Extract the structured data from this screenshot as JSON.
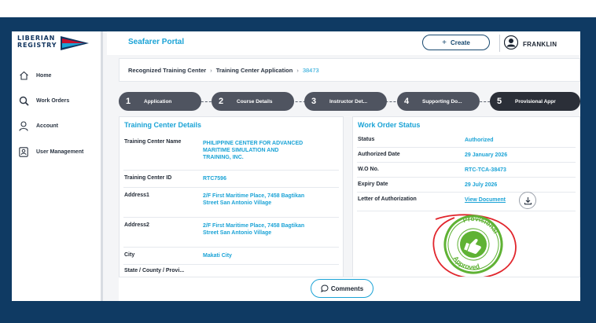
{
  "brand": {
    "logo_line1": "LIBERIAN",
    "logo_line2": "REGISTRY",
    "logo_colors": [
      "#c8102e",
      "#12355f",
      "#1ba3d6"
    ]
  },
  "sidebar": {
    "items": [
      {
        "label": "Home",
        "icon": "home-icon"
      },
      {
        "label": "Work Orders",
        "icon": "search-icon"
      },
      {
        "label": "Account",
        "icon": "user-icon"
      },
      {
        "label": "User Management",
        "icon": "user-management-icon"
      }
    ]
  },
  "header": {
    "title": "Seafarer Portal",
    "create_label": "Create",
    "user_name": "FRANKLIN"
  },
  "breadcrumb": {
    "items": [
      "Recognized Training Center",
      "Training Center Application"
    ],
    "current": "38473"
  },
  "stepper": {
    "steps": [
      {
        "number": "1",
        "label": "Application"
      },
      {
        "number": "2",
        "label": "Course Details"
      },
      {
        "number": "3",
        "label": "Instructor Det..."
      },
      {
        "number": "4",
        "label": "Supporting Do..."
      },
      {
        "number": "5",
        "label": "Provisional Appr"
      }
    ]
  },
  "training_center": {
    "title": "Training Center Details",
    "rows": [
      {
        "label": "Training Center Name",
        "value": "PHILIPPINE CENTER FOR ADVANCED MARITIME SIMULATION AND TRAINING, INC."
      },
      {
        "label": "Training Center ID",
        "value": "RTC7596"
      },
      {
        "label": "Address1",
        "value": "2/F First Maritime Place, 7458 Bagtikan Street San Antonio Village"
      },
      {
        "label": "Address2",
        "value": "2/F First Maritime Place, 7458 Bagtikan Street San Antonio Village"
      },
      {
        "label": "City",
        "value": "Makati City"
      },
      {
        "label": "State / County / Provi...",
        "value": ""
      }
    ]
  },
  "work_order": {
    "title": "Work Order Status",
    "rows": [
      {
        "label": "Status",
        "value": "Authorized"
      },
      {
        "label": "Authorized Date",
        "value": "29 January 2026"
      },
      {
        "label": "W.O No.",
        "value": "RTC-TCA-38473"
      },
      {
        "label": "Expiry Date",
        "value": "29 July 2026"
      },
      {
        "label": "Letter of Authorization",
        "value": "View Document"
      }
    ],
    "stamp_text_top": "Provisional",
    "stamp_text_bottom": "Approved",
    "stamp_color": "#5fb234",
    "circle_color": "#e1252c"
  },
  "footer": {
    "comments_label": "Comments"
  }
}
